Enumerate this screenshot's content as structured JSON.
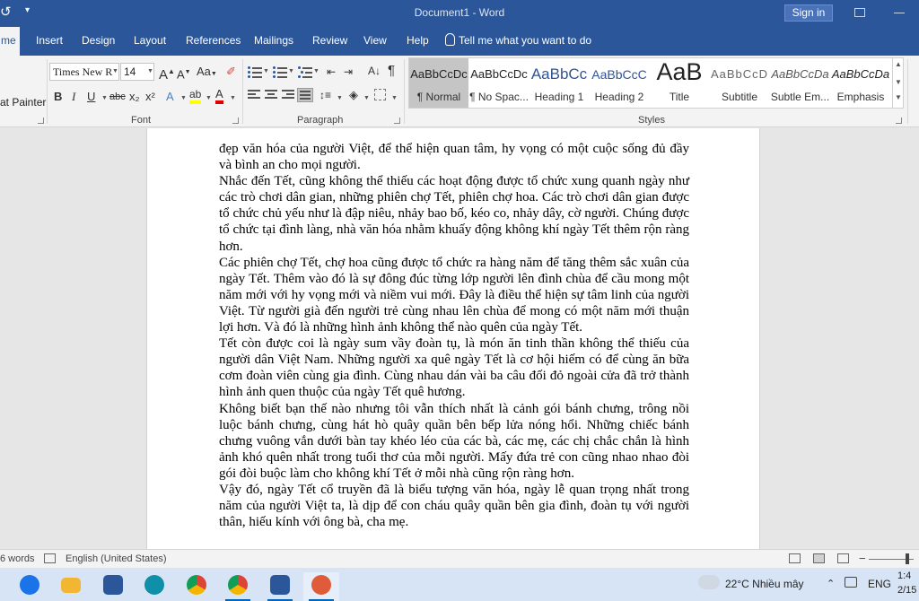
{
  "titlebar": {
    "title": "Document1  -  Word",
    "signin_label": "Sign in"
  },
  "tabs": [
    {
      "label": "me"
    },
    {
      "label": "Insert"
    },
    {
      "label": "Design"
    },
    {
      "label": "Layout"
    },
    {
      "label": "References"
    },
    {
      "label": "Mailings"
    },
    {
      "label": "Review"
    },
    {
      "label": "View"
    },
    {
      "label": "Help"
    }
  ],
  "tell_me": "Tell me what you want to do",
  "ribbon": {
    "clipboard": {
      "format_painter": "at Painter"
    },
    "font": {
      "group_label": "Font",
      "font_name": "Times New R",
      "font_size": "14",
      "case_label": "Aa",
      "bold": "B",
      "italic": "I",
      "underline": "U",
      "strike": "abc",
      "subscript": "x₂",
      "superscript": "x²",
      "text_effects": "A",
      "highlight": "ab",
      "font_color": "A"
    },
    "paragraph": {
      "group_label": "Paragraph"
    },
    "styles": {
      "group_label": "Styles",
      "items": [
        {
          "sample": "AaBbCcDc",
          "name": "¶ Normal"
        },
        {
          "sample": "AaBbCcDc",
          "name": "¶ No Spac..."
        },
        {
          "sample": "AaBbCc",
          "name": "Heading 1"
        },
        {
          "sample": "AaBbCcC",
          "name": "Heading 2"
        },
        {
          "sample": "AaB",
          "name": "Title"
        },
        {
          "sample": "AaBbCcD",
          "name": "Subtitle"
        },
        {
          "sample": "AaBbCcDa",
          "name": "Subtle Em..."
        },
        {
          "sample": "AaBbCcDa",
          "name": "Emphasis"
        }
      ]
    }
  },
  "document": {
    "paragraphs": [
      "đẹp văn hóa của người Việt, để thể hiện quan tâm, hy vọng có một cuộc sống đủ đầy và bình an cho mọi người.",
      "Nhắc đến Tết, cũng không thể thiếu các hoạt động được tổ chức xung quanh ngày như các trò chơi dân gian, những phiên chợ Tết, phiên chợ hoa. Các trò chơi dân gian được tổ chức chủ yếu như là đập niêu, nhảy bao bố, kéo co, nhảy dây, cờ người. Chúng được tổ chức tại đình làng, nhà văn hóa nhằm khuấy động không khí ngày Tết thêm rộn ràng hơn.",
      "Các phiên chợ Tết, chợ hoa cũng được tổ chức ra hàng năm để tăng thêm sắc xuân của ngày Tết. Thêm vào đó là sự đông đúc từng lớp người lên đình chùa để cầu mong một năm mới với hy vọng mới và niềm vui mới. Đây là điều thể hiện sự tâm linh của người Việt. Từ người già đến người trẻ cùng nhau lên chùa để mong có một năm mới thuận lợi hơn. Và đó là những hình ảnh không thể nào quên của ngày Tết.",
      "Tết còn được coi là ngày sum vầy đoàn tụ, là món ăn tinh thần không thể thiếu của người dân Việt Nam. Những người xa quê ngày Tết là cơ hội hiếm có để cùng ăn bữa cơm đoàn viên cùng gia đình. Cùng nhau dán vài ba câu đối đỏ ngoài cửa đã trở thành hình ảnh quen thuộc của ngày Tết quê hương.",
      "Không biết bạn thế nào nhưng tôi vẫn thích nhất là cảnh gói bánh chưng, trông nồi luộc bánh chưng, cùng hát hò quây quần bên bếp lửa nóng hổi. Những chiếc bánh chưng vuông vắn dưới bàn tay khéo léo của các bà, các mẹ, các chị chắc chắn là hình ảnh khó quên nhất trong tuổi thơ của mỗi người. Mấy đứa trẻ con cũng nhao nhao đòi gói đòi buộc làm cho không khí Tết ở mỗi nhà cũng rộn ràng hơn.",
      "Vậy đó, ngày Tết cổ truyền đã là biểu tượng văn hóa, ngày lễ quan trọng nhất trong năm của người Việt ta, là dịp để con cháu quây quần bên gia đình, đoàn tụ với người thân, hiếu kính với ông bà, cha mẹ."
    ]
  },
  "statusbar": {
    "word_count": "6 words",
    "language": "English (United States)"
  },
  "taskbar": {
    "apps": [
      {
        "name": "Zalo",
        "color": "#1a73e8"
      },
      {
        "name": "File Explorer",
        "color": "#f2b632"
      },
      {
        "name": "Microsoft Store",
        "color": "#2b579a"
      },
      {
        "name": "Edge",
        "color": "#0f8fa8"
      },
      {
        "name": "Chrome",
        "color": "#db4437"
      },
      {
        "name": "Chrome Profile",
        "color": "#34a853"
      },
      {
        "name": "Word",
        "color": "#2b579a"
      },
      {
        "name": "Snipping Tool",
        "color": "#e05b3a"
      }
    ],
    "weather": "22°C  Nhiều mây",
    "input_lang": "ENG",
    "time": "1:4",
    "date": "2/15"
  },
  "colors": {
    "word_blue": "#2b579a",
    "ribbon_bg": "#f3f3f3",
    "taskbar_bg": "#d6e4f5"
  }
}
